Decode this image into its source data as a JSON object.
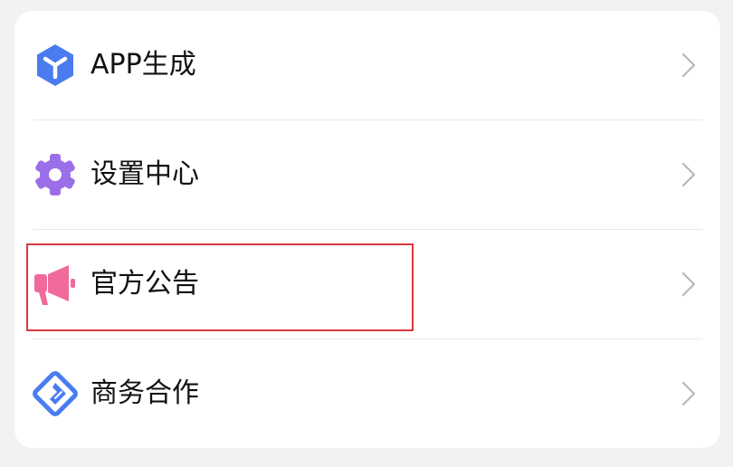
{
  "menu": {
    "items": [
      {
        "label": "APP生成",
        "icon": "app-cube-icon",
        "color": "#4a7cf0"
      },
      {
        "label": "设置中心",
        "icon": "gear-icon",
        "color": "#9b6fe8"
      },
      {
        "label": "官方公告",
        "icon": "megaphone-icon",
        "color": "#f06a9c"
      },
      {
        "label": "商务合作",
        "icon": "handshake-icon",
        "color": "#4a7cf0"
      }
    ],
    "highlight_color": "#d9383d"
  }
}
